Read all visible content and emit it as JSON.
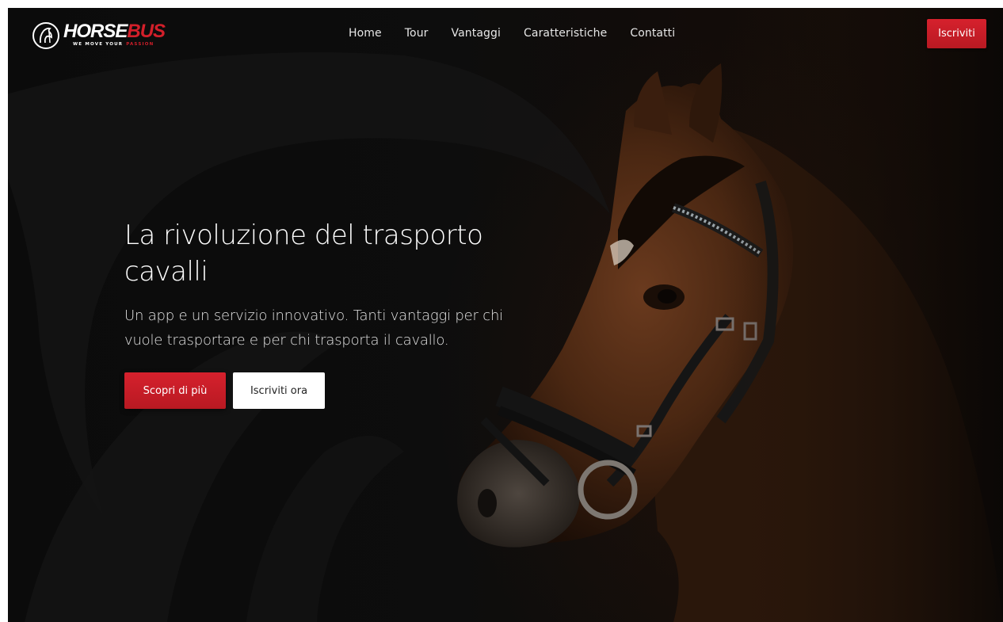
{
  "brand": {
    "name_part1": "HORSE",
    "name_part2": "BUS",
    "tagline_part1": "WE MOVE YOUR",
    "tagline_part2": "PASSION",
    "accent_color": "#d31f2a"
  },
  "nav": {
    "items": [
      {
        "label": "Home"
      },
      {
        "label": "Tour"
      },
      {
        "label": "Vantaggi"
      },
      {
        "label": "Caratteristiche"
      },
      {
        "label": "Contatti"
      }
    ],
    "cta_label": "Iscriviti"
  },
  "hero": {
    "headline": "La rivoluzione del trasporto cavalli",
    "subhead": "Un app e un servizio innovativo. Tanti vantaggi per chi vuole trasportare e per chi trasporta il cavallo.",
    "primary_button": "Scopri di più",
    "secondary_button": "Iscriviti ora",
    "background_image": "horse-head-bridle-photo"
  }
}
